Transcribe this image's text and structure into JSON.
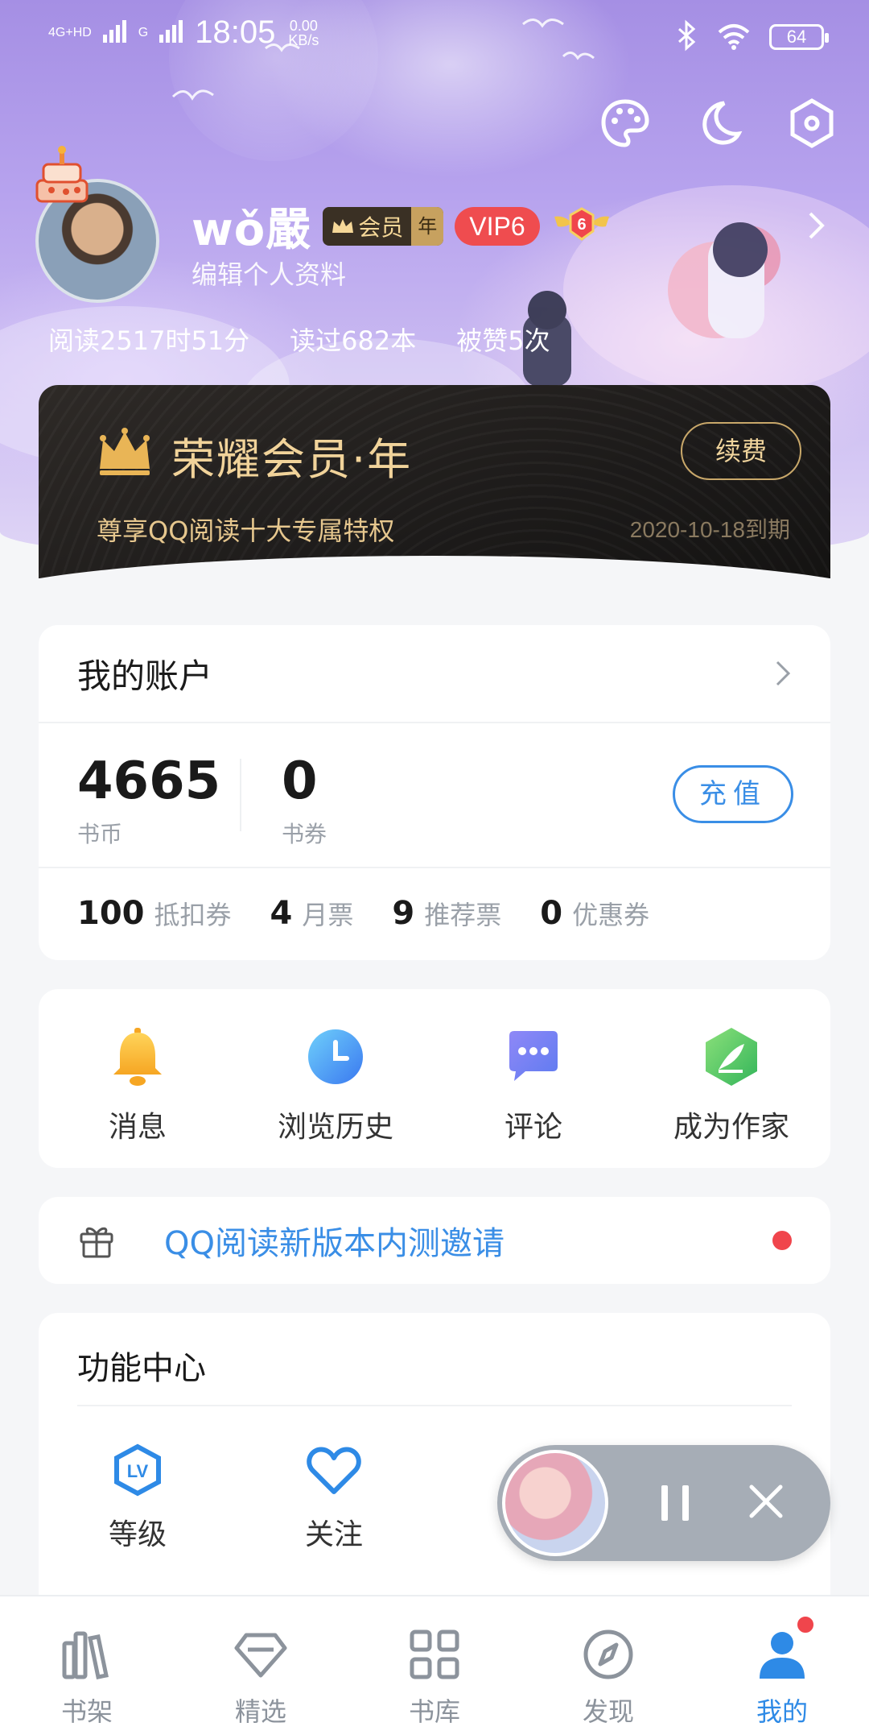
{
  "status_bar": {
    "network1": "4G+HD",
    "network2": "G",
    "time": "18:05",
    "speed_value": "0.00",
    "speed_unit": "KB/s",
    "battery": "64"
  },
  "profile": {
    "username": "wǒ嚴",
    "member_label": "会员",
    "member_term": "年",
    "vip_level": "VIP6",
    "badge_level": "6",
    "edit_label": "编辑个人资料",
    "stats": [
      "阅读2517时51分",
      "读过682本",
      "被赞5次"
    ]
  },
  "vip_card": {
    "title": "荣耀会员·年",
    "subtitle": "尊享QQ阅读十大专属特权",
    "expire": "2020-10-18到期",
    "renew_label": "续费"
  },
  "account": {
    "title": "我的账户",
    "coins_value": "4665",
    "coins_label": "书币",
    "vouchers_value": "0",
    "vouchers_label": "书券",
    "recharge_label": "充值",
    "tickets": [
      {
        "value": "100",
        "label": "抵扣券"
      },
      {
        "value": "4",
        "label": "月票"
      },
      {
        "value": "9",
        "label": "推荐票"
      },
      {
        "value": "0",
        "label": "优惠券"
      }
    ]
  },
  "quick_actions": [
    {
      "label": "消息",
      "icon": "bell-icon"
    },
    {
      "label": "浏览历史",
      "icon": "clock-icon"
    },
    {
      "label": "评论",
      "icon": "chat-bubble-icon"
    },
    {
      "label": "成为作家",
      "icon": "quill-icon"
    }
  ],
  "invite": {
    "text": "QQ阅读新版本内测邀请",
    "icon": "gift-icon"
  },
  "function_center": {
    "title": "功能中心",
    "items": [
      {
        "label": "等级",
        "icon": "level-icon"
      },
      {
        "label": "关注",
        "icon": "heart-icon"
      }
    ]
  },
  "bottom_nav": [
    {
      "label": "书架",
      "icon": "bookshelf-icon"
    },
    {
      "label": "精选",
      "icon": "diamond-icon"
    },
    {
      "label": "书库",
      "icon": "grid-icon"
    },
    {
      "label": "发现",
      "icon": "compass-icon"
    },
    {
      "label": "我的",
      "icon": "profile-icon"
    }
  ],
  "colors": {
    "accent": "#3a8ee6",
    "vip_red": "#ef4c4f",
    "gold": "#e9c98c",
    "notify_dot": "#f0454c"
  }
}
